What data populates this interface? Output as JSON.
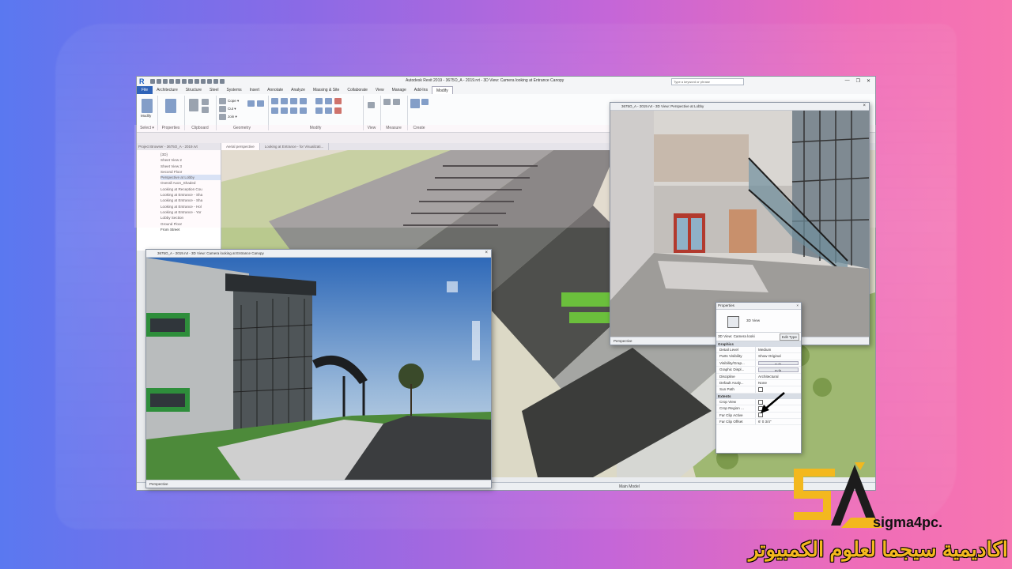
{
  "app": {
    "logo_letter": "R",
    "title": "Autodesk Revit 2019 - 3675O_A - 2019.rvt - 3D View: Camera looking at Entrance Canopy",
    "search_placeholder": "Type a keyword or phrase",
    "win_buttons": [
      "—",
      "❐",
      "✕"
    ]
  },
  "menu_tabs": [
    "File",
    "Architecture",
    "Structure",
    "Steel",
    "Systems",
    "Insert",
    "Annotate",
    "Analyze",
    "Massing & Site",
    "Collaborate",
    "View",
    "Manage",
    "Add-Ins",
    "Modify"
  ],
  "ribbon": {
    "select_label": "Select ▾",
    "modify_label": "Modify",
    "groups": [
      "Properties",
      "Clipboard",
      "Geometry",
      "Modify",
      "View",
      "Measure",
      "Create"
    ],
    "geometry_items": [
      "Cope ▾",
      "Cut ▾",
      "Join ▾"
    ]
  },
  "project_browser": {
    "title": "Project Browser - 3675O_A - 2019.rvt",
    "items": [
      "{3D}",
      "Sheet View 2",
      "Sheet View 3",
      "Second Floor",
      "Perspective at Lobby",
      "Overall Axon_Shaded",
      "Looking at Reception Cou",
      "Looking at Entrance - Sha",
      "Looking at Entrance - Sha",
      "Looking at Entrance - Hol",
      "Looking at Entrance - Yor",
      "Lobby Section",
      "Ground Floor",
      "From Street"
    ],
    "selected_index": 4
  },
  "view_tabs": [
    "Aerial perspective",
    "Looking at Entrance - for Visualizati..."
  ],
  "windows": {
    "canopy": {
      "title": "3675O_A - 2019.rvt - 3D View: Camera looking at Entrance Canopy",
      "footer": "Perspective"
    },
    "lobby": {
      "title": "3675O_A - 2019.rvt - 3D View: Perspective at Lobby",
      "footer": "Perspective"
    }
  },
  "properties": {
    "title": "Properties",
    "type_name": "3D View",
    "selector": "3D View: Camera looki",
    "edit_type": "Edit Type",
    "categories": {
      "graphics": "Graphics",
      "extents": "Extents"
    },
    "graphics_rows": [
      {
        "k": "Detail Level",
        "v": "Medium"
      },
      {
        "k": "Parts Visibility",
        "v": "Show Original"
      },
      {
        "k": "Visibility/Grap...",
        "v": "Edit..."
      },
      {
        "k": "Graphic Displ...",
        "v": "Edit..."
      },
      {
        "k": "Discipline",
        "v": "Architectural"
      },
      {
        "k": "Default Analy...",
        "v": "None"
      },
      {
        "k": "Sun Path",
        "v": ""
      }
    ],
    "extent_rows": [
      {
        "k": "Crop View",
        "v": ""
      },
      {
        "k": "Crop Region ...",
        "v": ""
      },
      {
        "k": "Far Clip Active",
        "v": ""
      },
      {
        "k": "Far Clip Offset",
        "v": "6' 0 3/4\""
      }
    ]
  },
  "statusbar": {
    "text": "Main Model"
  },
  "brand": {
    "name": "sigma4pc.",
    "arabic": "اكاديمية سيجما لعلوم الكمبيوتر"
  },
  "colors": {
    "brand_yellow": "#f3b81e",
    "revit_blue": "#2f63b8"
  }
}
